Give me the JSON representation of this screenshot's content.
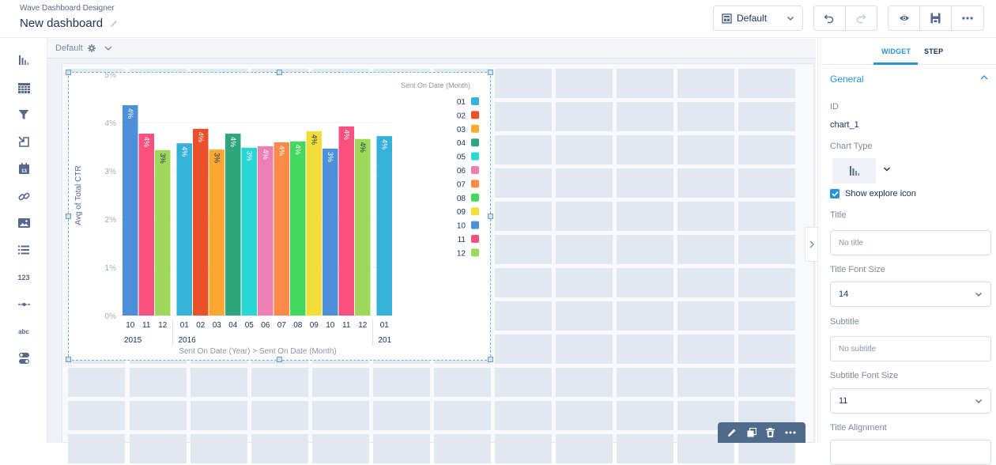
{
  "header": {
    "app_name": "Wave Dashboard Designer",
    "dashboard_title": "New dashboard",
    "layout_select": {
      "value": "Default",
      "icon": "layout-icon"
    },
    "undo_icon": "undo-icon",
    "redo_icon": "redo-icon",
    "preview_icon": "eye-icon",
    "save_icon": "save-icon",
    "more_icon": "more-icon"
  },
  "left_rail": {
    "items": [
      {
        "name": "chart",
        "icon": "bar-chart-icon"
      },
      {
        "name": "table",
        "icon": "table-icon"
      },
      {
        "name": "filter",
        "icon": "filter-icon"
      },
      {
        "name": "link-in",
        "icon": "import-icon"
      },
      {
        "name": "date",
        "icon": "calendar-icon",
        "text": "13"
      },
      {
        "name": "link",
        "icon": "link-icon"
      },
      {
        "name": "image",
        "icon": "image-icon"
      },
      {
        "name": "list",
        "icon": "list-icon"
      },
      {
        "name": "number",
        "icon": "number-icon",
        "text": "123"
      },
      {
        "name": "range",
        "icon": "slider-icon",
        "text": "-•-"
      },
      {
        "name": "text",
        "icon": "text-icon",
        "text": "abc"
      },
      {
        "name": "toggle",
        "icon": "toggle-icon"
      }
    ]
  },
  "canvas": {
    "layout_name": "Default",
    "widget_toolbar": {
      "edit_icon": "pencil-icon",
      "clone_icon": "clone-icon",
      "delete_icon": "trash-icon",
      "more_icon": "more-icon"
    }
  },
  "chart_data": {
    "type": "bar",
    "title": "",
    "xlabel": "Sent On Date (Year) > Sent On Date (Month)",
    "ylabel": "Avg of Total CTR",
    "ylim": [
      0,
      5
    ],
    "yticks": [
      "0%",
      "1%",
      "2%",
      "3%",
      "4%",
      "5%"
    ],
    "grid": true,
    "legend_title": "Sent On Date (Month)",
    "legend_position": "top-right",
    "legend": [
      {
        "label": "01",
        "color": "#36b1da"
      },
      {
        "label": "02",
        "color": "#e9512a"
      },
      {
        "label": "03",
        "color": "#fba731"
      },
      {
        "label": "04",
        "color": "#2ea57b"
      },
      {
        "label": "05",
        "color": "#2ad6d5"
      },
      {
        "label": "06",
        "color": "#ed7fb4"
      },
      {
        "label": "07",
        "color": "#fc8b4a"
      },
      {
        "label": "08",
        "color": "#43d75e"
      },
      {
        "label": "09",
        "color": "#f4dc3a"
      },
      {
        "label": "10",
        "color": "#4b90d8"
      },
      {
        "label": "11",
        "color": "#f95080"
      },
      {
        "label": "12",
        "color": "#9ed75a"
      }
    ],
    "groups": [
      {
        "year": "2015",
        "months": [
          "10",
          "11",
          "12"
        ],
        "values": [
          4.36,
          3.77,
          3.43
        ],
        "labels": [
          "4%",
          "4%",
          "3%"
        ]
      },
      {
        "year": "2016",
        "months": [
          "01",
          "02",
          "03",
          "04",
          "05",
          "06",
          "07",
          "08",
          "09",
          "10",
          "11",
          "12"
        ],
        "values": [
          3.57,
          3.87,
          3.44,
          3.77,
          3.48,
          3.51,
          3.59,
          3.61,
          3.82,
          3.46,
          3.92,
          3.66
        ],
        "labels": [
          "4%",
          "4%",
          "3%",
          "4%",
          "3%",
          "4%",
          "4%",
          "4%",
          "4%",
          "3%",
          "4%",
          "4%"
        ]
      },
      {
        "year": "201",
        "months": [
          "01"
        ],
        "values": [
          3.72
        ],
        "labels": [
          "4%"
        ]
      }
    ]
  },
  "right_panel": {
    "tabs": [
      "WIDGET",
      "STEP"
    ],
    "active_tab": "WIDGET",
    "section": "General",
    "id_label": "ID",
    "id_value": "chart_1",
    "chart_type_label": "Chart Type",
    "show_explore_label": "Show explore icon",
    "show_explore_checked": true,
    "title_label": "Title",
    "title_placeholder": "No title",
    "title_font_size_label": "Title Font Size",
    "title_font_size": "14",
    "subtitle_label": "Subtitle",
    "subtitle_placeholder": "No subtitle",
    "subtitle_font_size_label": "Subtitle Font Size",
    "subtitle_font_size": "11",
    "title_alignment_label": "Title Alignment"
  }
}
